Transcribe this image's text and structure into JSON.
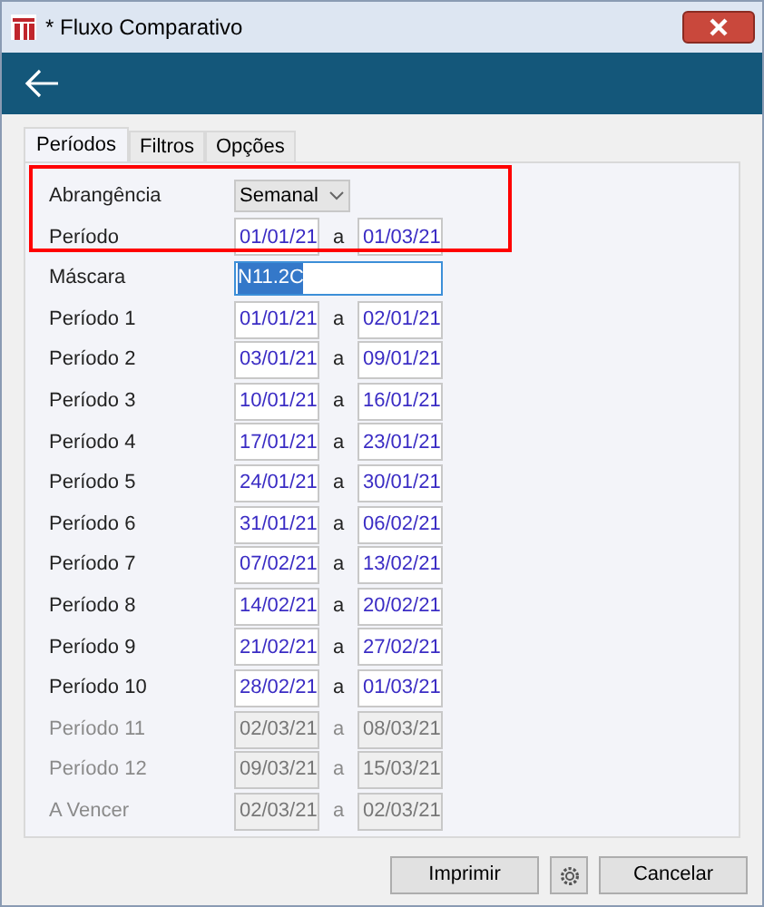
{
  "window": {
    "title": "* Fluxo Comparativo"
  },
  "tabs": [
    {
      "label": "Períodos",
      "selected": true
    },
    {
      "label": "Filtros",
      "selected": false
    },
    {
      "label": "Opções",
      "selected": false
    }
  ],
  "highlighted": {
    "abrangencia": {
      "label": "Abrangência",
      "value": "Semanal"
    },
    "periodo": {
      "label": "Período",
      "from": "01/01/21",
      "separator": "a",
      "to": "01/03/21"
    }
  },
  "mascara": {
    "label": "Máscara",
    "value": "N11.2C"
  },
  "periods": [
    {
      "label": "Período 1",
      "from": "01/01/21",
      "separator": "a",
      "to": "02/01/21",
      "disabled": false
    },
    {
      "label": "Período 2",
      "from": "03/01/21",
      "separator": "a",
      "to": "09/01/21",
      "disabled": false
    },
    {
      "label": "Período 3",
      "from": "10/01/21",
      "separator": "a",
      "to": "16/01/21",
      "disabled": false
    },
    {
      "label": "Período 4",
      "from": "17/01/21",
      "separator": "a",
      "to": "23/01/21",
      "disabled": false
    },
    {
      "label": "Período 5",
      "from": "24/01/21",
      "separator": "a",
      "to": "30/01/21",
      "disabled": false
    },
    {
      "label": "Período 6",
      "from": "31/01/21",
      "separator": "a",
      "to": "06/02/21",
      "disabled": false
    },
    {
      "label": "Período 7",
      "from": "07/02/21",
      "separator": "a",
      "to": "13/02/21",
      "disabled": false
    },
    {
      "label": "Período 8",
      "from": "14/02/21",
      "separator": "a",
      "to": "20/02/21",
      "disabled": false
    },
    {
      "label": "Período 9",
      "from": "21/02/21",
      "separator": "a",
      "to": "27/02/21",
      "disabled": false
    },
    {
      "label": "Período 10",
      "from": "28/02/21",
      "separator": "a",
      "to": "01/03/21",
      "disabled": false
    },
    {
      "label": "Período 11",
      "from": "02/03/21",
      "separator": "a",
      "to": "08/03/21",
      "disabled": true
    },
    {
      "label": "Período 12",
      "from": "09/03/21",
      "separator": "a",
      "to": "15/03/21",
      "disabled": true
    },
    {
      "label": "A Vencer",
      "from": "02/03/21",
      "separator": "a",
      "to": "02/03/21",
      "disabled": true
    }
  ],
  "buttons": {
    "print": "Imprimir",
    "cancel": "Cancelar"
  }
}
